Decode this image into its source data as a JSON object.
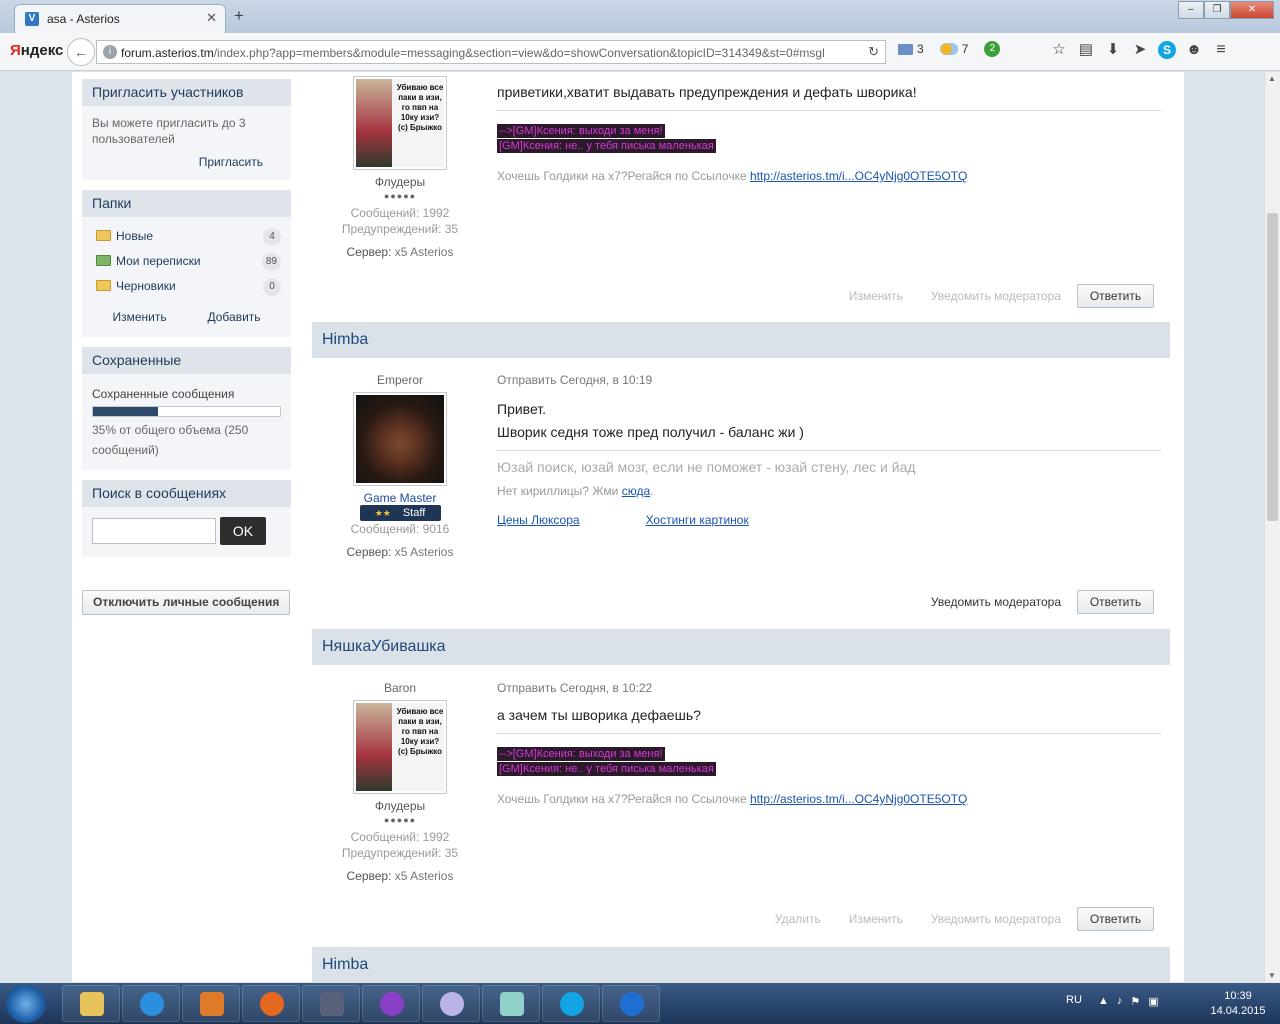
{
  "browser": {
    "tab_title": "asa - Asterios",
    "tab_close": "✕",
    "tab_new": "+",
    "window_buttons": [
      "–",
      "❐",
      "✕"
    ],
    "logo_first": "Я",
    "logo_rest": "ндекс",
    "back": "←",
    "url_host": "forum.asterios.tm",
    "url_rest": "/index.php?app=members&module=messaging&section=view&do=showConversation&topicID=314349&st=0#msgl",
    "reload": "↻",
    "mail_count": "3",
    "weather_temp": "7",
    "badge_count": "2",
    "tool_icons": [
      "☆",
      "▤",
      "⬇",
      "➤",
      "S",
      "☻",
      "≡"
    ]
  },
  "sidebar": {
    "invite": {
      "title": "Пригласить участников",
      "text": "Вы можете пригласить до 3 пользователей",
      "link": "Пригласить"
    },
    "folders": {
      "title": "Папки",
      "items": [
        {
          "label": "Новые",
          "count": "4"
        },
        {
          "label": "Мои переписки",
          "count": "89"
        },
        {
          "label": "Черновики",
          "count": "0"
        }
      ],
      "edit": "Изменить",
      "add": "Добавить"
    },
    "saved": {
      "title": "Сохраненные",
      "label": "Сохраненные сообщения",
      "usage": "35% от общего объема (250 сообщений)",
      "percent": 35
    },
    "search": {
      "title": "Поиск в сообщениях",
      "button": "OK"
    },
    "disable_pm": "Отключить личные сообщения"
  },
  "posts": [
    {
      "author": "",
      "rank": "",
      "group": "Флудеры",
      "pips": "●●●●●",
      "avatar_caption": "Убиваю все паки в изи, го пвп на 10ку изи? (c) Брыжко",
      "messages_count": "Сообщений: 1992",
      "warnings": "Предупреждений: 35",
      "server_label": "Сервер:",
      "server": "x5 Asterios",
      "date": "",
      "body": [
        "приветики,хватит выдавать предупреждения и дефать шворика!"
      ],
      "sig_dark": [
        "-->[GM]Ксения: выходи за меня!",
        "[GM]Ксения: не.. у тебя писька маленькая"
      ],
      "sig_text": "Хочешь Голдики на х7?Регайся по Ссылочке",
      "sig_link": "http://asterios.tm/i...OC4yNjg0OTE5OTQ",
      "actions": [
        "Изменить",
        "Уведомить модератора"
      ],
      "reply": "Ответить"
    },
    {
      "author": "Himba",
      "rank": "Emperor",
      "group": "Game Master",
      "staff_stars": "★★",
      "staff": "Staff",
      "messages_count": "Сообщений: 9016",
      "server_label": "Сервер:",
      "server": "x5 Asterios",
      "date": "Отправить Сегодня, в 10:19",
      "body": [
        "Привет.",
        "Шворик седня тоже пред получил - баланс жи )"
      ],
      "sig_quote": "Юзай поиск, юзай мозг, если не поможет - юзай стену, лес и йад",
      "sig_text": "Нет кириллицы? Жми",
      "sig_link": "сюда",
      "sig_link_dot": ".",
      "links": [
        "Цены Люксора",
        "Хостинги картинок"
      ],
      "actions": [
        "Уведомить модератора"
      ],
      "reply": "Ответить"
    },
    {
      "author": "НяшкаУбивашка",
      "rank": "Baron",
      "group": "Флудеры",
      "pips": "●●●●●",
      "avatar_caption": "Убиваю все паки в изи, го пвп на 10ку изи? (c) Брыжко",
      "messages_count": "Сообщений: 1992",
      "warnings": "Предупреждений: 35",
      "server_label": "Сервер:",
      "server": "x5 Asterios",
      "date": "Отправить Сегодня, в 10:22",
      "body": [
        "а зачем ты шворика дефаешь?"
      ],
      "sig_dark": [
        "-->[GM]Ксения: выходи за меня!",
        "[GM]Ксения: не.. у тебя писька маленькая"
      ],
      "sig_text": "Хочешь Голдики на х7?Регайся по Ссылочке",
      "sig_link": "http://asterios.tm/i...OC4yNjg0OTE5OTQ",
      "actions": [
        "Удалить",
        "Изменить",
        "Уведомить модератора"
      ],
      "reply": "Ответить"
    },
    {
      "author": "Himba"
    }
  ],
  "taskbar": {
    "lang": "RU",
    "time": "10:39",
    "date": "14.04.2015"
  },
  "colors": {
    "accent": "#1f4a7a",
    "staff_bg": "#1f3556",
    "signature_bg": "#2a1a2a",
    "signature_fg": "#d838d8"
  }
}
